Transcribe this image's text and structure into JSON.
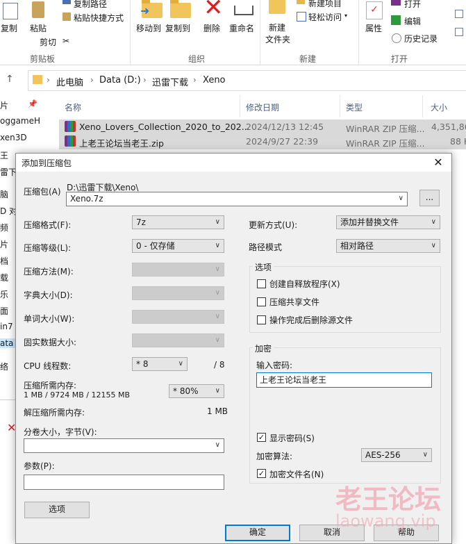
{
  "ribbon": {
    "clipboard": {
      "copy": "复制",
      "paste": "粘贴",
      "copy_path": "复制路径",
      "paste_shortcut": "粘贴快捷方式",
      "cut": "剪切",
      "group": "剪贴板"
    },
    "organize": {
      "move_to": "移动到",
      "copy_to": "复制到",
      "delete": "删除",
      "rename": "重命名",
      "group": "组织"
    },
    "new": {
      "new_item": "新建项目",
      "easy_access": "轻松访问",
      "new_folder_line1": "新建",
      "new_folder_line2": "文件夹",
      "group": "新建"
    },
    "open": {
      "properties": "属性",
      "open": "打开",
      "edit": "编辑",
      "history": "历史记录",
      "group": "打开"
    }
  },
  "address": {
    "crumbs": [
      "此电脑",
      "Data (D:)",
      "迅雷下载",
      "Xeno"
    ]
  },
  "nav_pane": [
    "片",
    "oggameH",
    "xen3D",
    "王",
    "雷下",
    "脑",
    "D 对",
    "频",
    "片",
    "档",
    "载",
    "乐",
    "面",
    "in7",
    "ata (",
    "络"
  ],
  "file_list": {
    "columns": [
      "名称",
      "修改日期",
      "类型",
      "大小"
    ],
    "rows": [
      {
        "name": "Xeno_Lovers_Collection_2020_to_202...",
        "date": "2024/12/13 12:45",
        "type": "WinRAR ZIP 压缩...",
        "size": "4,351,862"
      },
      {
        "name": "上老王论坛当老王.zip",
        "date": "2024/9/27 22:39",
        "type": "WinRAR ZIP 压缩...",
        "size": "88 K"
      }
    ]
  },
  "dialog": {
    "title": "添加到压缩包",
    "archive_label": "压缩包(A)",
    "archive_path": "D:\\迅雷下载\\Xeno\\",
    "archive_name": "Xeno.7z",
    "browse": "...",
    "format_label": "压缩格式(F):",
    "format_value": "7z",
    "level_label": "压缩等级(L):",
    "level_value": "0 - 仅存储",
    "method_label": "压缩方法(M):",
    "dict_label": "字典大小(D):",
    "word_label": "单词大小(W):",
    "solid_label": "固实数据大小:",
    "threads_label": "CPU 线程数:",
    "threads_value": "* 8",
    "threads_max": "/ 8",
    "mem_label": "压缩所需内存:",
    "mem_detail": "1 MB / 9724 MB / 12155 MB",
    "mem_value": "* 80%",
    "decomp_label": "解压缩所需内存:",
    "decomp_value": "1 MB",
    "split_label": "分卷大小，字节(V):",
    "params_label": "参数(P):",
    "options_button": "选项",
    "update_label": "更新方式(U):",
    "update_value": "添加并替换文件",
    "pathmode_label": "路径模式",
    "pathmode_value": "相对路径",
    "options_group": "选项",
    "opt_sfx": "创建自释放程序(X)",
    "opt_shared": "压缩共享文件",
    "opt_delete": "操作完成后删除源文件",
    "encrypt_group": "加密",
    "password_label": "输入密码:",
    "password_value": "上老王论坛当老王",
    "show_password": "显示密码(S)",
    "enc_method_label": "加密算法:",
    "enc_method_value": "AES-256",
    "encrypt_names": "加密文件名(N)",
    "ok": "确定",
    "cancel": "取消",
    "help": "帮助"
  },
  "watermark": {
    "big": "老王论坛",
    "small": "laowang.vip"
  }
}
